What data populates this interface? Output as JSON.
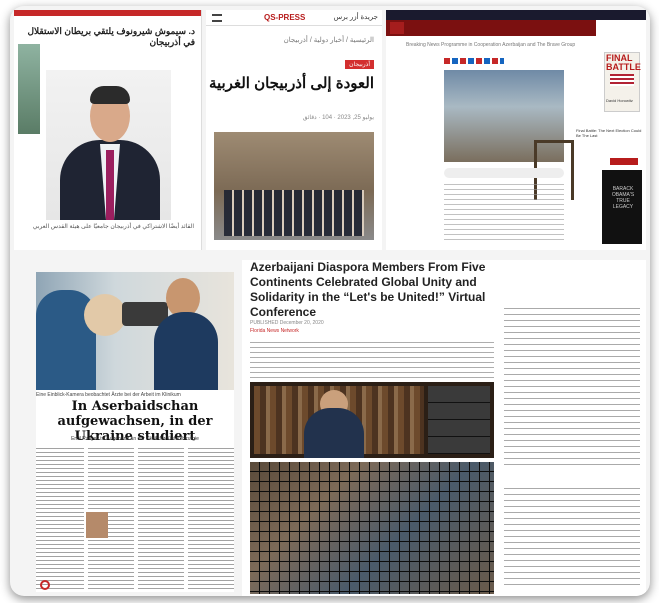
{
  "p1": {
    "headline": "د. سيموش شيرونوف يلتقي بريطان الاستقلال في أذربيجان",
    "caption": "القائد أيضًا الاشتراكي في أذربيجان جامعيًا على هيئة القدس العربي"
  },
  "p2": {
    "brand": "QS-PRESS",
    "brand_ar": "جريدة أزر برس",
    "breadcrumb": "الرئيسية / أخبار دولية / أذربيجان",
    "tag": "أذربيجان",
    "title": "العودة إلى أذربيجان الغربية",
    "meta": "يوليو 25, 2023 · 104 · دقائق"
  },
  "p3": {
    "breaking": "Breaking News Programme in Cooperation Azerbaijan and The Brave Group",
    "book_title": "FINAL BATTLE",
    "book_author": "David Horowitz",
    "sidecap": "Final Battle: The Next Election Could Be The Last",
    "book2_title": "BARACK OBAMA'S TRUE LEGACY"
  },
  "p4": {
    "caption": "Eine Einblick-Kamera beobachtet Ärzte bei der Arbeit im Klinikum",
    "headline": "In Aserbaidschan aufgewachsen, in der Ukraine studiert",
    "deck": "Emil Rzayev ist Augenarzt an der Klinik für Kieferchirurgie"
  },
  "p5": {
    "title": "Azerbaijani Diaspora Members From Five Continents Celebrated Global Unity and Solidarity in the “Let's be United!” Virtual Conference",
    "byline": "PUBLISHED December 20, 2020",
    "byline_link": "Florida News Network"
  }
}
